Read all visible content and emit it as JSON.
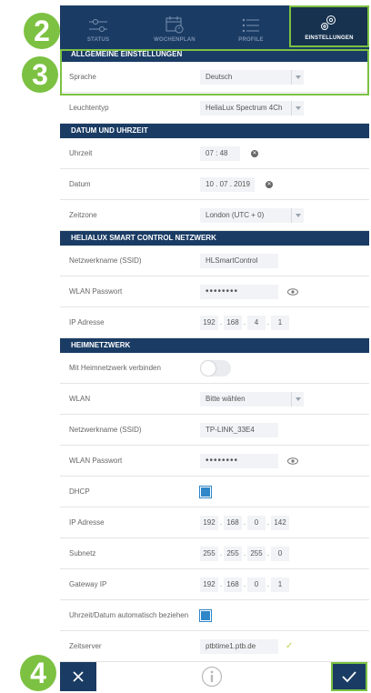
{
  "steps": [
    "2",
    "3",
    "4"
  ],
  "nav": {
    "tabs": [
      {
        "label": "STATUS",
        "icon": "sliders-icon"
      },
      {
        "label": "WOCHENPLAN",
        "icon": "calendar-icon"
      },
      {
        "label": "PROFILE",
        "icon": "list-icon"
      },
      {
        "label": "EINSTELLUNGEN",
        "icon": "gears-icon",
        "active": true
      }
    ]
  },
  "general": {
    "title": "ALLGEMEINE EINSTELLUNGEN",
    "language_label": "Sprache",
    "language_value": "Deutsch",
    "lamp_label": "Leuchtentyp",
    "lamp_value": "HeliaLux Spectrum 4Ch"
  },
  "datetime": {
    "title": "DATUM UND UHRZEIT",
    "time_label": "Uhrzeit",
    "time_value": "07 : 48",
    "date_label": "Datum",
    "date_value": "10 . 07 . 2019",
    "tz_label": "Zeitzone",
    "tz_value": "London (UTC + 0)"
  },
  "helialux_net": {
    "title": "HELIALUX SMART CONTROL NETZWERK",
    "ssid_label": "Netzwerkname (SSID)",
    "ssid_value": "HLSmartControl",
    "pw_label": "WLAN Passwort",
    "pw_value": "••••••••",
    "ip_label": "IP Adresse",
    "ip": [
      "192",
      "168",
      "4",
      "1"
    ]
  },
  "home_net": {
    "title": "HEIMNETZWERK",
    "connect_label": "Mit Heimnetzwerk verbinden",
    "connect_on": false,
    "wlan_label": "WLAN",
    "wlan_value": "Bitte wählen",
    "ssid_label": "Netzwerkname (SSID)",
    "ssid_value": "TP-LINK_33E4",
    "pw_label": "WLAN Passwort",
    "pw_value": "••••••••",
    "dhcp_label": "DHCP",
    "dhcp_checked": true,
    "ip_label": "IP Adresse",
    "ip": [
      "192",
      "168",
      "0",
      "142"
    ],
    "subnet_label": "Subnetz",
    "subnet": [
      "255",
      "255",
      "255",
      "0"
    ],
    "gateway_label": "Gateway IP",
    "gateway": [
      "192",
      "168",
      "0",
      "1"
    ],
    "autotime_label": "Uhrzeit/Datum automatisch beziehen",
    "autotime_checked": true,
    "timeserver_label": "Zeitserver",
    "timeserver_value": "ptbtime1.ptb.de"
  },
  "colors": {
    "navy": "#1a3c64",
    "accent_green": "#7cc142",
    "checkbox_blue": "#2f86c9"
  },
  "bottom": {
    "cancel_icon": "close-icon",
    "info_icon": "info-icon",
    "confirm_icon": "checkmark-icon"
  }
}
